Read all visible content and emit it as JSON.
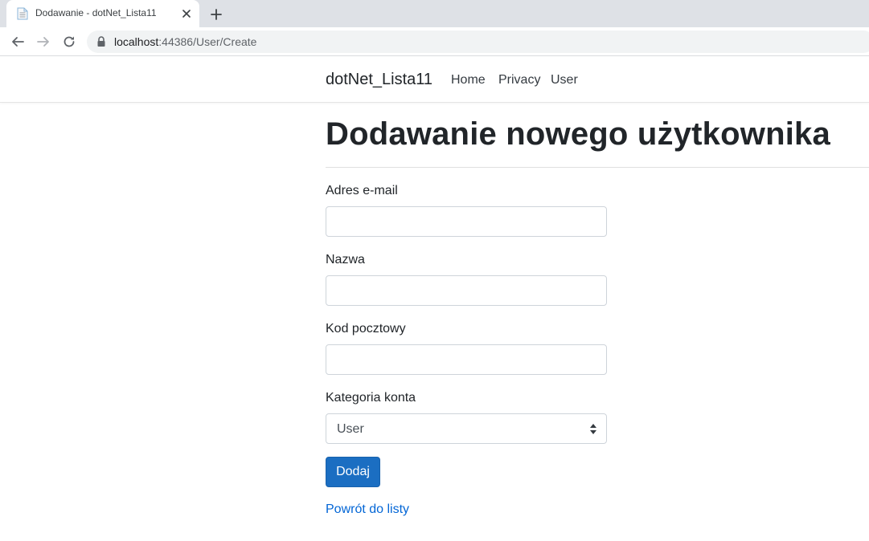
{
  "browser": {
    "tab_title": "Dodawanie - dotNet_Lista11",
    "url_host": "localhost",
    "url_rest": ":44386/User/Create"
  },
  "navbar": {
    "brand": "dotNet_Lista11",
    "links": [
      "Home",
      "Privacy",
      "User"
    ]
  },
  "form": {
    "title": "Dodawanie nowego użytkownika",
    "email_label": "Adres e-mail",
    "email_value": "",
    "name_label": "Nazwa",
    "name_value": "",
    "postal_label": "Kod pocztowy",
    "postal_value": "",
    "category_label": "Kategoria konta",
    "category_selected": "User",
    "submit_label": "Dodaj",
    "back_link": "Powrót do listy"
  },
  "colors": {
    "primary_button": "#1b6ec2",
    "link": "#0366d6"
  },
  "icons": [
    "page-favicon-icon",
    "close-icon",
    "plus-icon",
    "back-arrow-icon",
    "forward-arrow-icon",
    "reload-icon",
    "lock-icon",
    "select-arrows-icon"
  ]
}
